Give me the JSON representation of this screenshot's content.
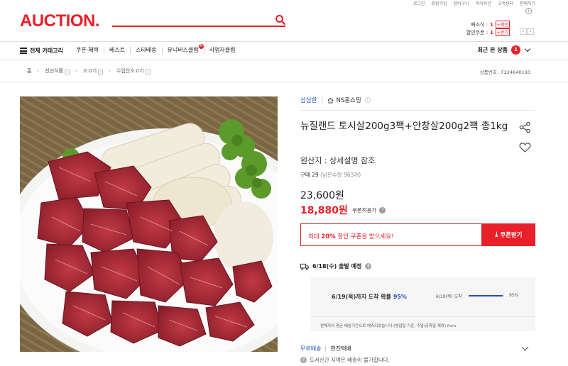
{
  "header": {
    "logo": "AUCTION.",
    "util_links": [
      "로그인",
      "회원가입",
      "장바구니",
      "마이옥션",
      "고객센터",
      "판매하기"
    ],
    "benefits": [
      {
        "label": "페소식 :",
        "num": "1",
        "badge": "+확인"
      },
      {
        "label": "할인쿠폰 :",
        "num": "1",
        "badge": "+받기"
      }
    ]
  },
  "nav": {
    "all_categories": "전체 카테고리",
    "items": [
      "쿠폰·혜택",
      "베스트",
      "스타배송",
      "유니버스클럽",
      "사업자클럽"
    ],
    "recent_label": "최근 본 상품",
    "recent_count": "1"
  },
  "breadcrumb": {
    "home": "홈",
    "levels": [
      "신선식품",
      "소고기",
      "수입산소고기"
    ],
    "product_no": "상품번호 : F224640193"
  },
  "product": {
    "image_alt": "소고기 토시살과 새송이버섯 플레이트",
    "seller": "삼삼한",
    "store": "NS홈쇼핑",
    "title": "뉴질랜드 토시살200g3팩+안창살200g2팩 총1kg",
    "origin": "원산지 : 상세설명 참조",
    "purchase_count": "구매 29",
    "remaining": "(남은수량 963개)",
    "original_price": "23,600원",
    "sale_price": "18,880원",
    "coupon_applied_label": "쿠폰적용가",
    "coupon_box_prefix": "최대",
    "coupon_box_pct": "20%",
    "coupon_box_suffix": "할인 쿠폰을 받으세요!",
    "coupon_button": "쿠폰받기"
  },
  "shipping": {
    "departure": "6/18(수) 출발 예정",
    "arrival_text": "6/19(목)까지 도착 확률",
    "arrival_pct": "95%",
    "bar_date": "6/19(목) 도착",
    "bar_value": 0.95,
    "bar_pct": "95%",
    "note": "판매자의 평균 배송기간으로 예측되었습니다 (영업일 기준, 주말/공휴일 제외)",
    "beta": "Beta",
    "free_label": "무료배송",
    "courier": "한진택배",
    "island_note": "도서산간 지역은 배송이 불가합니다."
  },
  "colors": {
    "brand_red": "#e8202a",
    "link_blue": "#2251b3"
  }
}
